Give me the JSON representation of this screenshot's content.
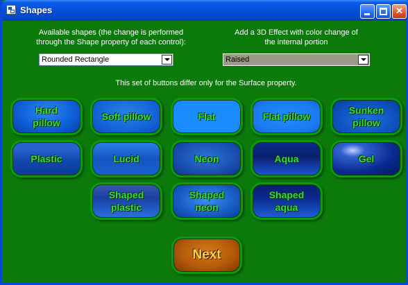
{
  "window": {
    "title": "Shapes",
    "controls": {
      "minimize": "",
      "maximize": "",
      "close": "✕"
    }
  },
  "shapes_panel": {
    "label_line1": "Available shapes (the change is performed",
    "label_line2": "through the Shape property of each control):",
    "selected": "Rounded Rectangle"
  },
  "effect_panel": {
    "label_line1": "Add a 3D Effect with color change of",
    "label_line2": "the internal portion",
    "selected": "Raised"
  },
  "info_text": "This set of buttons differ only for the Surface property.",
  "buttons": {
    "hard_pillow": {
      "line1": "Hard",
      "line2": "pillow"
    },
    "soft_pillow": {
      "line1": "Soft pillow"
    },
    "flat": {
      "line1": "Flat"
    },
    "flat_pillow": {
      "line1": "Flat pillow"
    },
    "sunken_pillow": {
      "line1": "Sunken",
      "line2": "pillow"
    },
    "plastic": {
      "line1": "Plastic"
    },
    "lucid": {
      "line1": "Lucid"
    },
    "neon": {
      "line1": "Neon"
    },
    "aqua": {
      "line1": "Aqua"
    },
    "gel": {
      "line1": "Gel"
    },
    "shaped_plastic": {
      "line1": "Shaped",
      "line2": "plastic"
    },
    "shaped_neon": {
      "line1": "Shaped",
      "line2": "neon"
    },
    "shaped_aqua": {
      "line1": "Shaped",
      "line2": "aqua"
    },
    "next": {
      "line1": "Next"
    }
  },
  "colors": {
    "background": "#0b7a0b",
    "button_text": "#2fe03a",
    "next_text": "#ffd24a",
    "titlebar": "#0550d8"
  }
}
